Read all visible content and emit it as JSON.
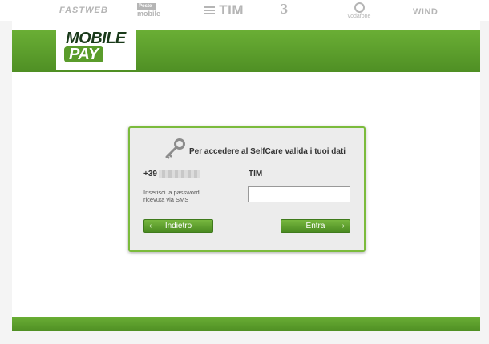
{
  "operators": {
    "fastweb": "FASTWEB",
    "postemobile_top": "Poste",
    "postemobile_main": "mobile",
    "tim": "TIM",
    "tre": "3",
    "vodafone": "vodafone",
    "wind": "WIND"
  },
  "logo": {
    "line1": "MOBILE",
    "line2": "PAY"
  },
  "dialog": {
    "title": "Per accedere al SelfCare valida i tuoi dati",
    "phone_prefix": "+39",
    "operator": "TIM",
    "password_hint": "Inserisci la password ricevuta via SMS",
    "password_value": "",
    "back_label": "Indietro",
    "enter_label": "Entra"
  },
  "icons": {
    "back_arrow": "‹",
    "enter_arrow": "›"
  },
  "colors": {
    "brand_green": "#5a9c2b",
    "dialog_border": "#7bbb3c"
  }
}
